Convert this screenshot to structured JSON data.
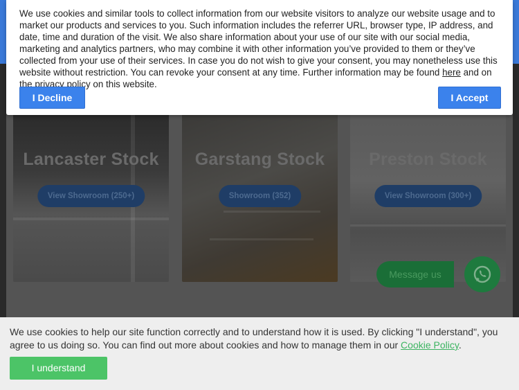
{
  "showrooms": [
    {
      "title": "Lancaster Stock",
      "button": "View Showroom (250+)"
    },
    {
      "title": "Garstang Stock",
      "button": "Showroom (352)"
    },
    {
      "title": "Preston Stock",
      "button": "View Showroom (300+)"
    }
  ],
  "chat": {
    "message_label": "Message us",
    "icon": "whatsapp-icon"
  },
  "consent": {
    "text_before_link": "We use cookies and similar tools to collect information from our website visitors to analyze our website usage and to market our products and services to you. Such information includes the referrer URL, browser type, IP address, and date, time and duration of the visit. We also share information about your use of our site with our social media, marketing and analytics partners, who may combine it with other information you’ve provided to them or they’ve collected from your use of their services. In case you do not wish to give your consent, you may nonetheless use this website without restriction. You can revoke your consent at any time. Further information may be found ",
    "link_text": "here",
    "text_after_link": " and on the privacy policy on this website.",
    "decline_label": "I Decline",
    "accept_label": "I Accept"
  },
  "cookie_bar": {
    "text": "We use cookies to help our site function correctly and to understand how it is used. By clicking \"I understand\", you agree to us doing so. You can find out more about cookies and how to manage them in our ",
    "link_text": "Cookie Policy",
    "text_end": ".",
    "button_label": "I understand"
  },
  "colors": {
    "accent_blue": "#3b82ec",
    "accent_green": "#4cc467",
    "link_green": "#3cb461"
  }
}
